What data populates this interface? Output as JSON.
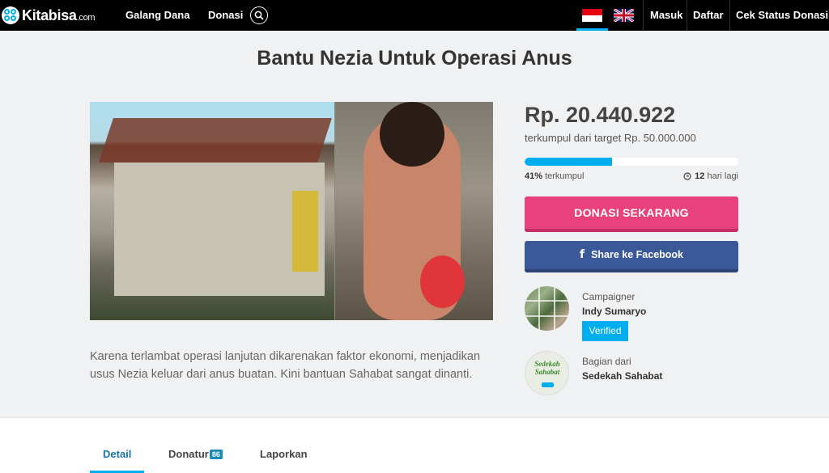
{
  "nav": {
    "logo_text": "Kitabisa",
    "logo_suffix": ".com",
    "links": [
      "Galang Dana",
      "Donasi"
    ],
    "languages": [
      "id-flag-icon",
      "uk-flag-icon"
    ],
    "right_links": [
      "Masuk",
      "Daftar",
      "Cek Status Donasi"
    ]
  },
  "campaign": {
    "title": "Bantu Nezia Untuk Operasi Anus",
    "description": "Karena terlambat operasi lanjutan dikarenakan faktor ekonomi, menjadikan usus Nezia keluar dari anus buatan. Kini bantuan Sahabat sangat dinanti.",
    "amount": "Rp. 20.440.922",
    "target_text": "terkumpul dari target Rp. 50.000.000",
    "progress_percent": 41,
    "percent_value": "41%",
    "percent_label": " terkumpul",
    "days_value": "12",
    "days_label": " hari lagi",
    "donate_button": "DONASI SEKARANG",
    "share_button": "Share ke Facebook"
  },
  "campaigner": {
    "label": "Campaigner",
    "name": "Indy Sumaryo",
    "badge": "Verified"
  },
  "group": {
    "label": "Bagian dari",
    "name": "Sedekah Sahabat",
    "logo_line1": "Sedekah",
    "logo_line2": "Sahabat"
  },
  "tabs": {
    "detail": "Detail",
    "donatur": "Donatur",
    "donatur_count": "86",
    "laporkan": "Laporkan"
  },
  "colors": {
    "accent": "#00aeef",
    "donate": "#e8427c",
    "facebook": "#3b5998"
  }
}
